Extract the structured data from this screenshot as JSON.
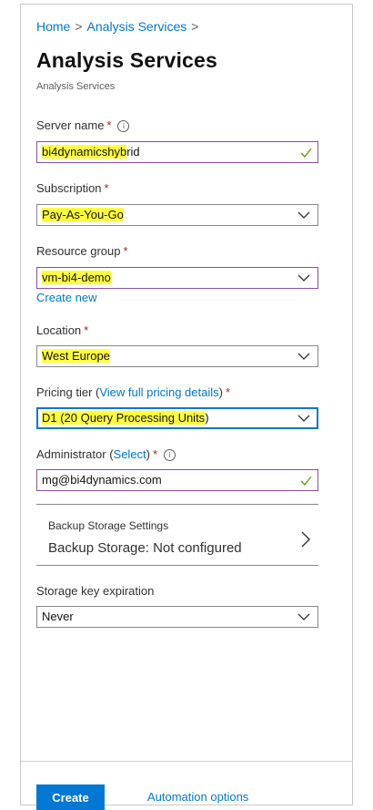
{
  "breadcrumb": {
    "items": [
      "Home",
      "Analysis Services"
    ],
    "separator": ">"
  },
  "header": {
    "title": "Analysis Services",
    "subtitle": "Analysis Services"
  },
  "form": {
    "server_name": {
      "label": "Server name",
      "required": "*",
      "value_highlighted": "bi4dynamicshyb",
      "value_rest": "rid",
      "valid": true
    },
    "subscription": {
      "label": "Subscription",
      "required": "*",
      "value": "Pay-As-You-Go"
    },
    "resource_group": {
      "label": "Resource group",
      "required": "*",
      "value": "vm-bi4-demo",
      "create_new": "Create new"
    },
    "location": {
      "label": "Location",
      "required": "*",
      "value": "West Europe"
    },
    "pricing_tier": {
      "label": "Pricing tier (",
      "link": "View full pricing details",
      "label_end": ")",
      "required": "*",
      "value_highlighted": "D1 (20 Query Processing Units",
      "value_rest": ")"
    },
    "administrator": {
      "label": "Administrator (",
      "link": "Select",
      "label_end": ")",
      "required": "*",
      "value": "mg@bi4dynamics.com",
      "valid": true
    },
    "backup": {
      "title": "Backup Storage Settings",
      "value": "Backup Storage: Not configured"
    },
    "storage_key_expiration": {
      "label": "Storage key expiration",
      "value": "Never"
    }
  },
  "footer": {
    "create_label": "Create",
    "automation_label": "Automation options"
  },
  "colors": {
    "accent": "#0078d4",
    "highlight": "#ffff3a",
    "required": "#a4262c",
    "valid_check": "#57a300"
  },
  "icons": [
    "info-icon",
    "chevron-down-icon",
    "checkmark-icon",
    "chevron-right-icon"
  ]
}
